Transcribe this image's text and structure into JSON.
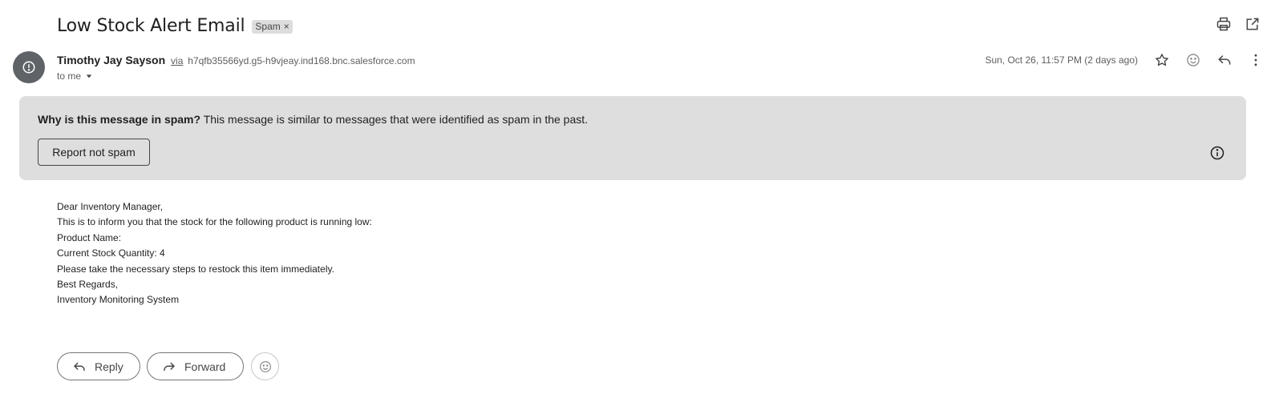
{
  "email": {
    "subject": "Low Stock Alert Email",
    "label": "Spam",
    "label_remove": "×",
    "sender_name": "Timothy Jay Sayson",
    "via": "via",
    "sender_domain": "h7qfb35566yd.g5-h9vjeay.ind168.bnc.salesforce.com",
    "recipient": "to me",
    "date": "Sun, Oct 26, 11:57 PM (2 days ago)"
  },
  "spam_banner": {
    "question": "Why is this message in spam?",
    "explanation": " This message is similar to messages that were identified as spam in the past.",
    "report_button": "Report not spam"
  },
  "body_lines": [
    "Dear Inventory Manager,",
    "This is to inform you that the stock for the following product is running low:",
    "Product Name:",
    "Current Stock Quantity: 4",
    "Please take the necessary steps to restock this item immediately.",
    "Best Regards,",
    "Inventory Monitoring System"
  ],
  "actions": {
    "reply": "Reply",
    "forward": "Forward"
  },
  "icons": {
    "top": [
      "print-icon",
      "open-in-new-window-icon"
    ],
    "meta": [
      "star-icon",
      "add-reaction-icon",
      "reply-icon",
      "more-options-icon"
    ],
    "avatar": "alert-icon",
    "banner": "info-icon"
  },
  "colors": {
    "avatar_bg": "#5f6368",
    "banner_bg": "#dedede",
    "chip_bg": "#dddddd"
  }
}
